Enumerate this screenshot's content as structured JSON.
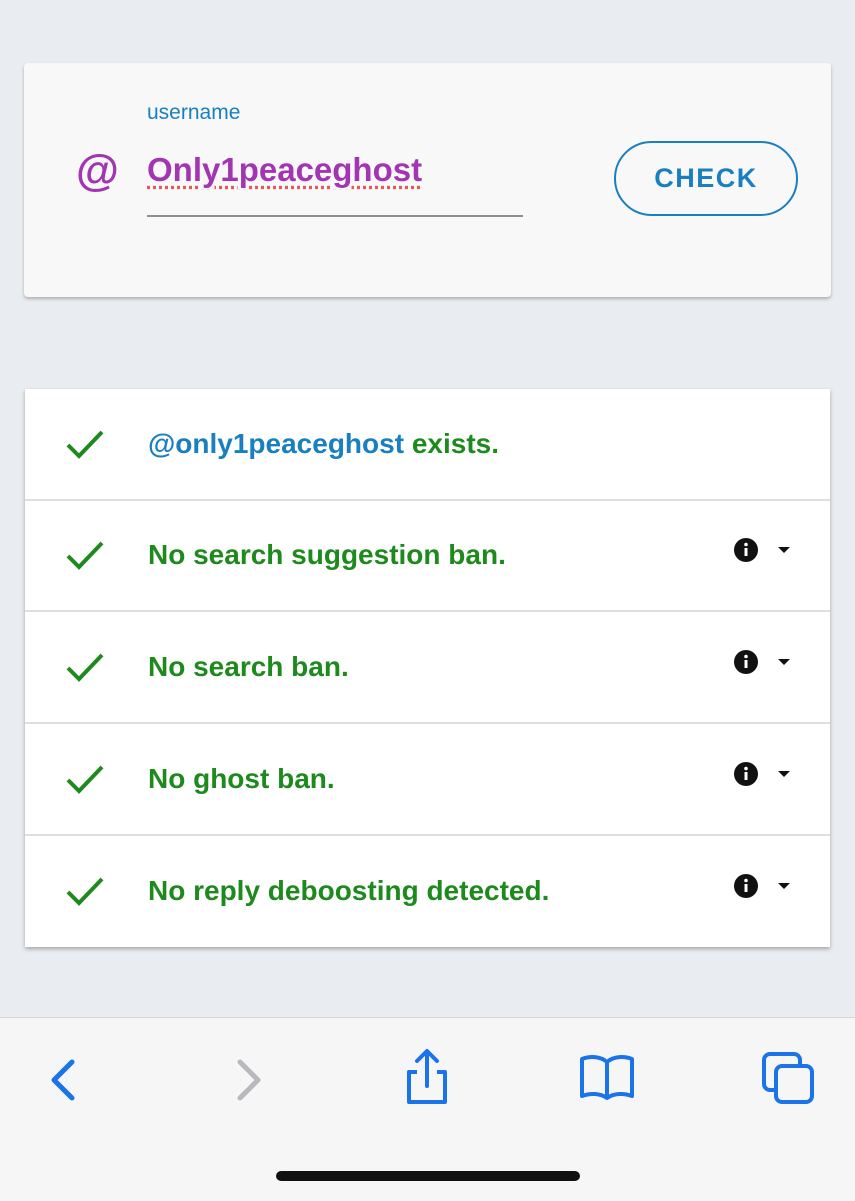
{
  "search": {
    "label": "username",
    "prefix_icon": "at-icon",
    "value": "Only1peaceghost",
    "button_label": "CHECK"
  },
  "results": [
    {
      "handle": "@only1peaceghost",
      "text": " exists.",
      "status": "ok",
      "has_info": false
    },
    {
      "handle": "",
      "text": "No search suggestion ban.",
      "status": "ok",
      "has_info": true
    },
    {
      "handle": "",
      "text": "No search ban.",
      "status": "ok",
      "has_info": true
    },
    {
      "handle": "",
      "text": "No ghost ban.",
      "status": "ok",
      "has_info": true
    },
    {
      "handle": "",
      "text": "No reply deboosting detected.",
      "status": "ok",
      "has_info": true
    }
  ],
  "toolbar": {
    "items": [
      "back-icon",
      "forward-icon",
      "share-icon",
      "bookmarks-icon",
      "tabs-icon"
    ]
  },
  "colors": {
    "accent_blue": "#1a7fc0",
    "username_purple": "#a135b2",
    "success_green": "#1e8a1e",
    "ios_blue": "#1a73e8",
    "disabled_gray": "#b9b9bd"
  }
}
